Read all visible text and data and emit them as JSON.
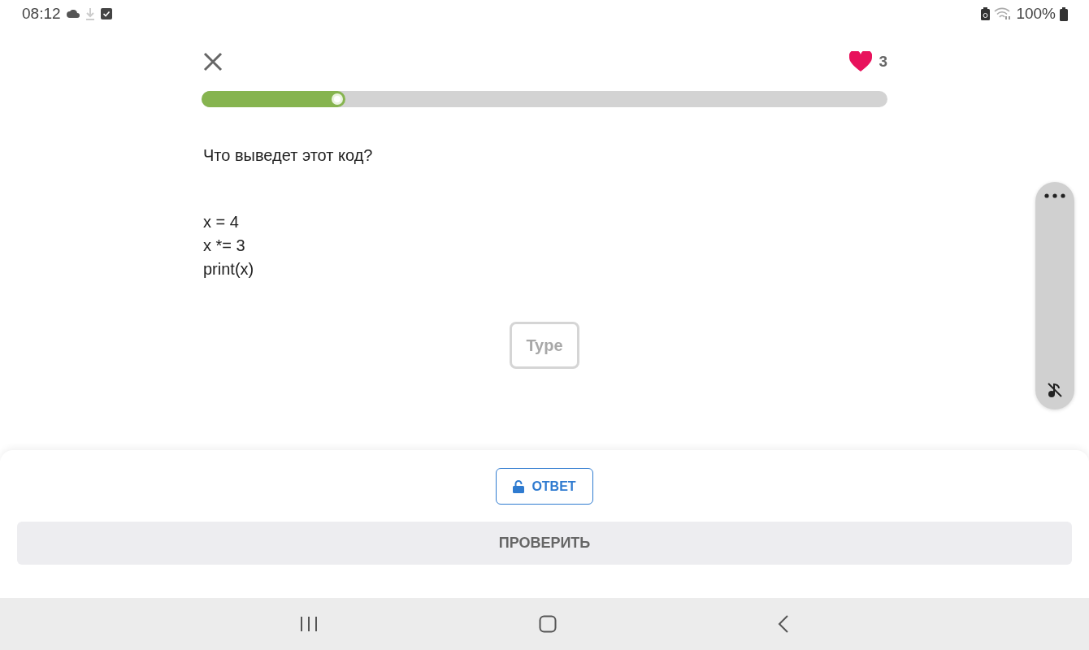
{
  "status_bar": {
    "time": "08:12",
    "battery": "100%"
  },
  "header": {
    "lives": "3",
    "progress": {
      "level": 0.21
    }
  },
  "question": "Что выведет этот код?",
  "code_lines": [
    "x = 4",
    "x *= 3",
    "print(x)"
  ],
  "answer_field": {
    "placeholder": "Type"
  },
  "sound_muted": true,
  "answer_button": {
    "label": "ОТВЕТ"
  },
  "check_button": {
    "label": "ПРОВЕРИТЬ",
    "disabled": true
  }
}
